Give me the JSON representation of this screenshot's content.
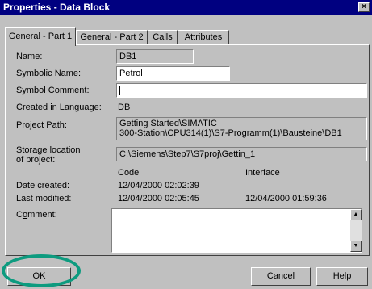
{
  "window": {
    "title": "Properties - Data Block",
    "close_glyph": "×"
  },
  "tabs": [
    {
      "label": "General - Part 1",
      "active": true
    },
    {
      "label": "General - Part 2",
      "active": false
    },
    {
      "label": "Calls",
      "active": false
    },
    {
      "label": "Attributes",
      "active": false
    }
  ],
  "form": {
    "name_label": "Name:",
    "name_value": "DB1",
    "symbolic_name_label_pre": "Symbolic ",
    "symbolic_name_label_key": "N",
    "symbolic_name_label_post": "ame:",
    "symbolic_name_value": "Petrol",
    "symbol_comment_label_pre": "Symbol ",
    "symbol_comment_label_key": "C",
    "symbol_comment_label_post": "omment:",
    "symbol_comment_value": "",
    "created_language_label": "Created in Language:",
    "created_language_value": "DB",
    "project_path_label": "Project Path:",
    "project_path_line1": "Getting Started\\SIMATIC",
    "project_path_line2": "300-Station\\CPU314(1)\\S7-Programm(1)\\Bausteine\\DB1",
    "storage_label_line1": "Storage location",
    "storage_label_line2": "of project:",
    "storage_value": "C:\\Siemens\\Step7\\S7proj\\Gettin_1",
    "col_code": "Code",
    "col_interface": "Interface",
    "date_created_label": "Date created:",
    "date_created_code": "12/04/2000  02:02:39",
    "last_modified_label": "Last modified:",
    "last_modified_code": "12/04/2000  02:05:45",
    "last_modified_interface": "12/04/2000  01:59:36",
    "comment_label_pre": "C",
    "comment_label_key": "o",
    "comment_label_post": "mment:",
    "comment_value": ""
  },
  "buttons": {
    "ok": "OK",
    "cancel": "Cancel",
    "help": "Help"
  },
  "colors": {
    "titlebar": "#000080",
    "dialog_face": "#c0c0c0",
    "highlight_ring": "#0d9b7f"
  }
}
